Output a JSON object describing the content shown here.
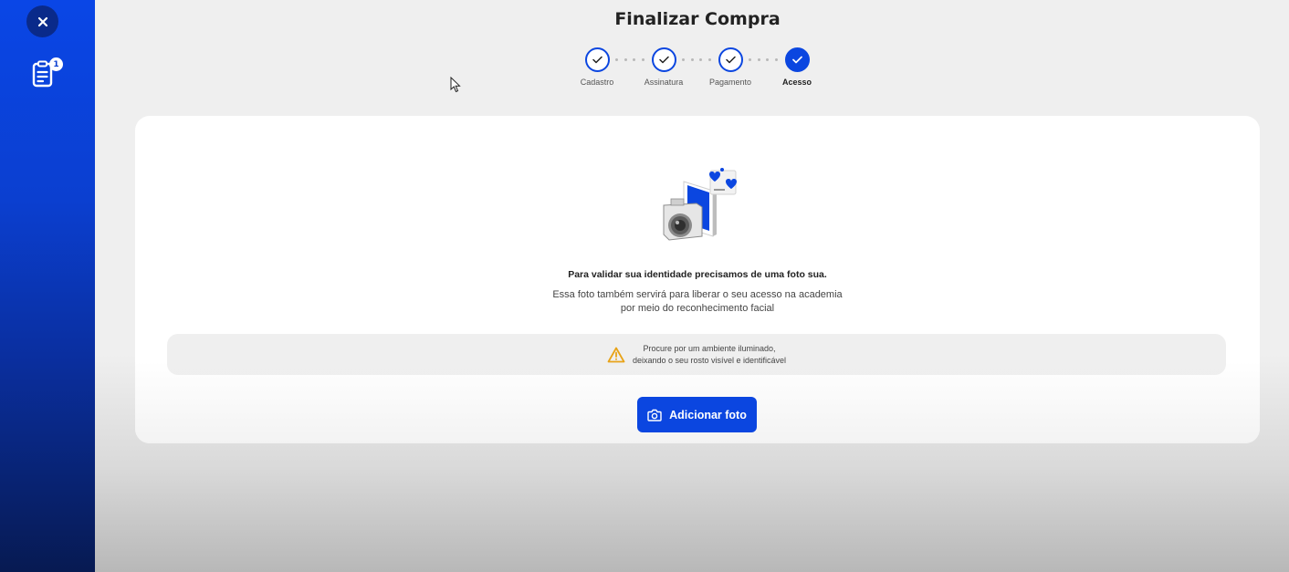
{
  "sidebar": {
    "close_icon": "close-icon",
    "document_icon": "document-icon",
    "document_badge": "1",
    "expand_icon": "double-chevron-right-icon"
  },
  "header": {
    "title": "Finalizar Compra"
  },
  "stepper": {
    "steps": [
      {
        "label": "Cadastro",
        "state": "completed"
      },
      {
        "label": "Assinatura",
        "state": "completed"
      },
      {
        "label": "Pagamento",
        "state": "completed"
      },
      {
        "label": "Acesso",
        "state": "active"
      }
    ]
  },
  "card": {
    "illustration": "camera-photo-illustration",
    "headline": "Para validar sua identidade precisamos de uma foto sua.",
    "subtext_line1": "Essa foto também servirá para liberar o seu acesso na academia",
    "subtext_line2": "por meio do reconhecimento facial",
    "tip_icon": "warning-icon",
    "tip_line1": "Procure por um ambiente iluminado,",
    "tip_line2": "deixando o seu rosto visível e identificável",
    "add_photo_label": "Adicionar foto",
    "add_photo_icon": "camera-icon"
  },
  "colors": {
    "primary": "#0b46e0",
    "sidebar_dark": "#071a52",
    "warning": "#e8a317"
  }
}
